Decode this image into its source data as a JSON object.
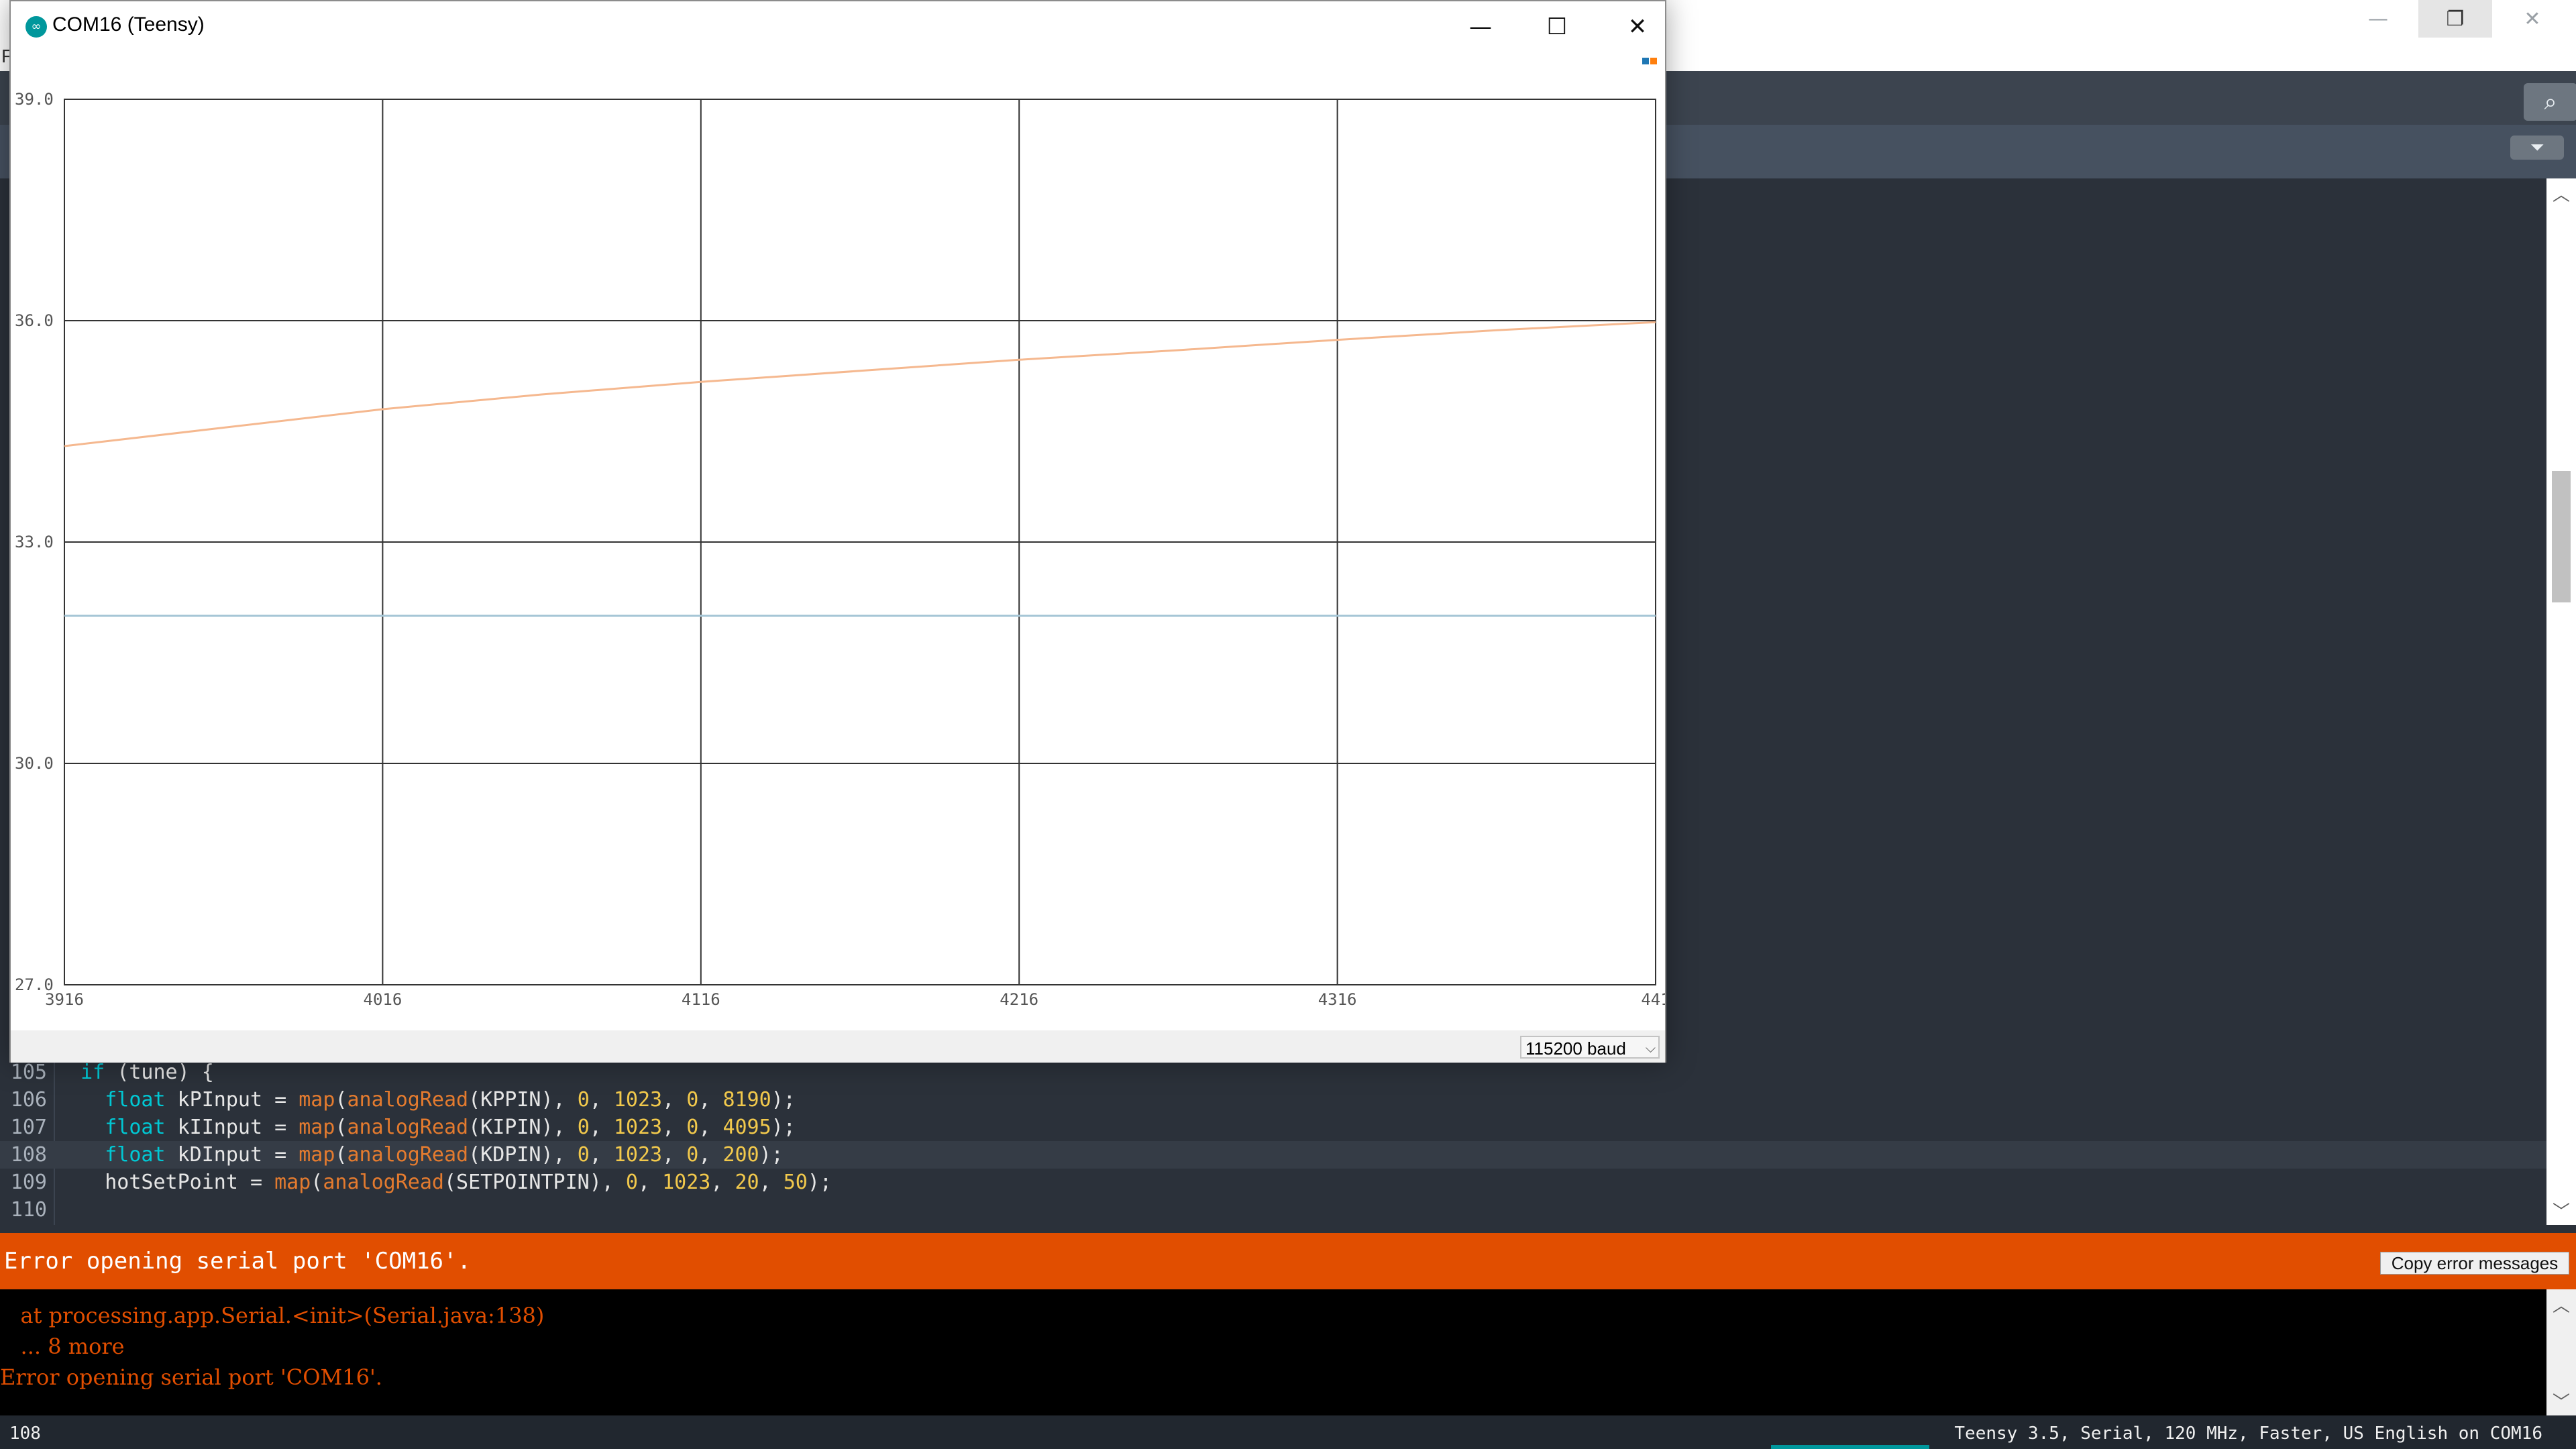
{
  "ide": {
    "menu_fragment": "F",
    "window_controls": {
      "minimize": "—",
      "restore": "❐",
      "close": "✕"
    },
    "toolbar": {
      "serial_monitor_icon": "serial-monitor-icon",
      "tab_menu_icon": "tab-menu-icon"
    },
    "code": [
      {
        "line": "105",
        "active": false,
        "html": "<span class=\"kw\">if</span> (tune) {"
      },
      {
        "line": "106",
        "active": false,
        "html": ""
      },
      {
        "line": "107",
        "active": false,
        "html": ""
      },
      {
        "line": "108",
        "active": true,
        "html": ""
      },
      {
        "line": "109",
        "active": false,
        "html": ""
      },
      {
        "line": "110",
        "active": false,
        "html": ""
      }
    ],
    "code_text": {
      "l105": "if (tune) {",
      "l106": "float kPInput = map(analogRead(KPPIN), 0, 1023, 0, 8190);",
      "l107": "float kIInput = map(analogRead(KIPIN), 0, 1023, 0, 4095);",
      "l108": "float kDInput = map(analogRead(KDPIN), 0, 1023, 0, 200);",
      "l109": "hotSetPoint = map(analogRead(SETPOINTPIN), 0, 1023, 20, 50);",
      "l110": ""
    },
    "error_bar": {
      "text": "Error opening serial port 'COM16'.",
      "copy_button": "Copy error messages"
    },
    "console": [
      "   at processing.app.Serial.<init>(Serial.java:138)",
      "   ... 8 more",
      "Error opening serial port 'COM16'."
    ],
    "status": {
      "line": "108",
      "board": "Teensy 3.5, Serial, 120 MHz, Faster, US English on COM16"
    },
    "colors": {
      "error": "#e14e00",
      "accent": "#00979c",
      "keyword": "#00c8d4",
      "function": "#e47b2f",
      "number": "#f2c94c"
    }
  },
  "plotter": {
    "title": "COM16 (Teensy)",
    "logo": "∞",
    "window_controls": {
      "minimize": "—",
      "maximize": "☐",
      "close": "✕"
    },
    "baud": "115200 baud",
    "baud_chevron": "⌵",
    "legend_colors": [
      "#1f77b4",
      "#ff7f0e"
    ]
  },
  "chart_data": {
    "type": "line",
    "title": "",
    "xlabel": "",
    "ylabel": "",
    "xlim": [
      3916,
      4416
    ],
    "ylim": [
      27.0,
      39.0
    ],
    "x_ticks": [
      "3916",
      "4016",
      "4116",
      "4216",
      "4316",
      "441"
    ],
    "y_ticks": [
      "39.0",
      "36.0",
      "33.0",
      "30.0",
      "27.0"
    ],
    "grid": true,
    "series": [
      {
        "color": "#f5b88f",
        "x": [
          3916,
          3966,
          4016,
          4066,
          4116,
          4166,
          4216,
          4266,
          4316,
          4366,
          4416
        ],
        "values": [
          34.3,
          34.55,
          34.8,
          35.0,
          35.17,
          35.32,
          35.47,
          35.6,
          35.74,
          35.87,
          35.98
        ]
      },
      {
        "color": "#a6c6d6",
        "x": [
          3916,
          4416
        ],
        "values": [
          32.0,
          32.0
        ]
      }
    ]
  }
}
